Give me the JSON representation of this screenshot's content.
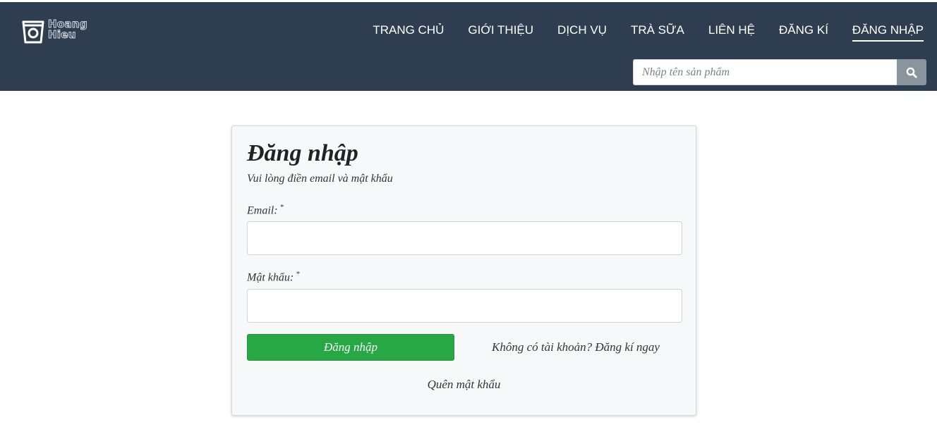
{
  "brand": {
    "logo_line1": "Hoang",
    "logo_line2": "Hieu"
  },
  "nav": {
    "items": [
      {
        "label": "TRANG CHỦ"
      },
      {
        "label": "GIỚI THIỆU"
      },
      {
        "label": "DỊCH VỤ"
      },
      {
        "label": "TRÀ SỮA"
      },
      {
        "label": "LIÊN HỆ"
      },
      {
        "label": "ĐĂNG KÍ"
      },
      {
        "label": "ĐĂNG NHẬP",
        "active": true
      }
    ]
  },
  "search": {
    "placeholder": "Nhập tên sản phẩm",
    "icon": "search-icon"
  },
  "login": {
    "title": "Đăng nhập",
    "subtitle": "Vui lòng điền email và mật khẩu",
    "email_label": "Email:",
    "password_label": "Mật khẩu:",
    "required_mark": "*",
    "email_value": "",
    "password_value": "",
    "submit_label": "Đăng nhập",
    "register_link": "Không có tài khoản? Đăng kí ngay",
    "forgot_link": "Quên mật khẩu"
  },
  "colors": {
    "navbar": "#2e3e50",
    "submit": "#28a745",
    "search_button": "#8a949d",
    "card_bg": "#f7f8fa"
  }
}
